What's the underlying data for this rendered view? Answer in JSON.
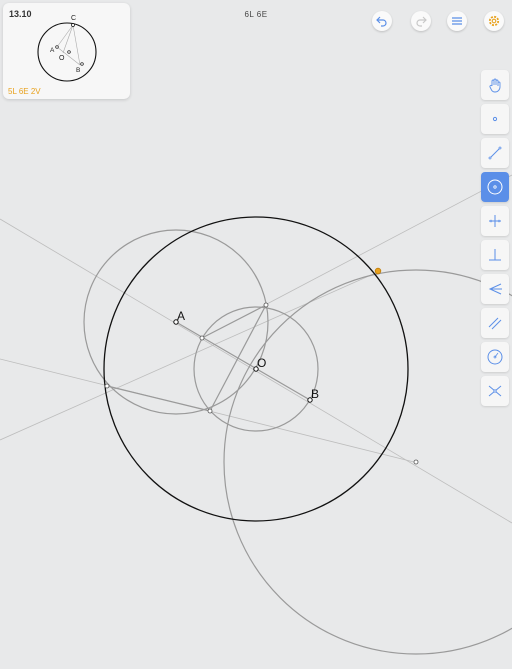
{
  "level": {
    "title": "13.10",
    "goals": "5L 6E 2V",
    "preview_labels": {
      "c": "C",
      "a": "A",
      "o": "O",
      "b": "B"
    }
  },
  "counter": {
    "text": "6L 6E"
  },
  "header_buttons": [
    {
      "name": "undo-button",
      "icon": "undo-icon"
    },
    {
      "name": "redo-button",
      "icon": "redo-icon"
    },
    {
      "name": "menu-button",
      "icon": "hamburger-icon"
    },
    {
      "name": "settings-button",
      "icon": "gear-icon"
    }
  ],
  "tools": [
    {
      "name": "tool-move",
      "icon": "hand-icon",
      "active": false
    },
    {
      "name": "tool-point",
      "icon": "point-icon",
      "active": false
    },
    {
      "name": "tool-line",
      "icon": "line-icon",
      "active": false
    },
    {
      "name": "tool-circle",
      "icon": "circle-icon",
      "active": true
    },
    {
      "name": "tool-perpendicular-bisector",
      "icon": "perpendicular-bisector-icon",
      "active": false
    },
    {
      "name": "tool-perpendicular",
      "icon": "perpendicular-icon",
      "active": false
    },
    {
      "name": "tool-angle-bisector",
      "icon": "angle-bisector-icon",
      "active": false
    },
    {
      "name": "tool-parallel",
      "icon": "parallel-icon",
      "active": false
    },
    {
      "name": "tool-compass",
      "icon": "compass-icon",
      "active": false
    },
    {
      "name": "tool-intersect",
      "icon": "intersect-icon",
      "active": false
    }
  ],
  "canvas": {
    "labels": {
      "a": "A",
      "o": "O",
      "b": "B"
    }
  },
  "colors": {
    "background": "#e8e9ea",
    "accent": "#5b8fe8",
    "goal": "#e8a21e",
    "construction": "#9a9a9a",
    "solution": "#111111"
  }
}
